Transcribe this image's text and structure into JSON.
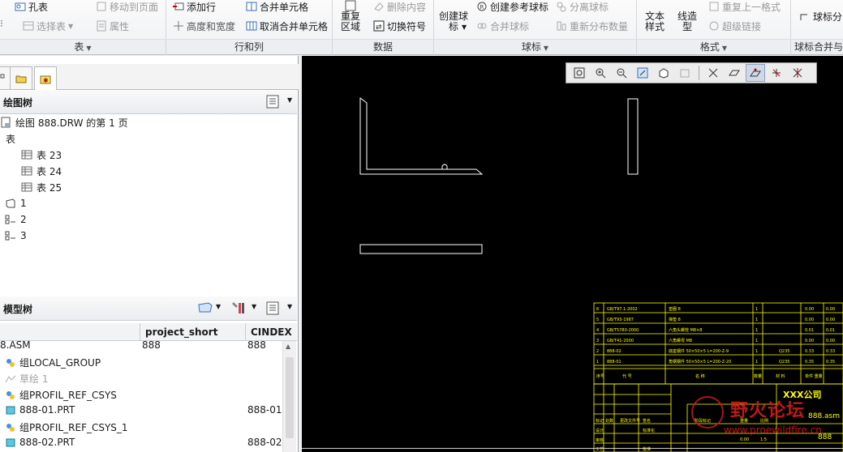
{
  "ribbon": {
    "groups": {
      "table": {
        "label": "表"
      },
      "rows_cols": {
        "label": "行和列"
      },
      "data": {
        "label": "数据"
      },
      "balloons": {
        "label": "球标"
      },
      "format": {
        "label": "格式"
      },
      "balloon_merge": {
        "label": "球标合并与"
      }
    },
    "buttons": {
      "hole_table": "孔表",
      "select_table": "选择表",
      "move_to_page": "移动到页面",
      "properties": "属性",
      "add_row": "添加行",
      "height_width": "高度和宽度",
      "merge_cells": "合并单元格",
      "unmerge_cells": "取消合并单元格",
      "repeat_region": "重复\n区域",
      "delete_content": "删除内容",
      "switch_symbol": "切换符号",
      "create_balloon": "创建球\n标",
      "create_ref_balloon": "创建参考球标",
      "merge_balloons": "合并球标",
      "detach_balloon": "分离球标",
      "redistribute_qty": "重新分布数量",
      "text_style": "文本\n样式",
      "line_style": "线造\n型",
      "repeat_last_format": "重复上一格式",
      "hyperlink": "超级链接",
      "balloon_split": "球标分"
    }
  },
  "drawing_tree": {
    "title": "绘图树",
    "items": [
      {
        "label": "绘图 888.DRW 的第 1 页"
      },
      {
        "label": "表"
      },
      {
        "label": "表 23"
      },
      {
        "label": "表 24"
      },
      {
        "label": "表 25"
      },
      {
        "label": "1"
      },
      {
        "label": "2"
      },
      {
        "label": "3"
      }
    ]
  },
  "model_tree": {
    "title": "模型树",
    "columns": [
      "project_short",
      "CINDEX"
    ],
    "rows": [
      {
        "name": "8.ASM",
        "project_short": "888",
        "cindex": "888"
      },
      {
        "name": "组LOCAL_GROUP",
        "project_short": "",
        "cindex": ""
      },
      {
        "name": "草绘 1",
        "project_short": "",
        "cindex": ""
      },
      {
        "name": "组PROFIL_REF_CSYS",
        "project_short": "",
        "cindex": ""
      },
      {
        "name": "888-01.PRT",
        "project_short": "",
        "cindex": "888-01"
      },
      {
        "name": "组PROFIL_REF_CSYS_1",
        "project_short": "",
        "cindex": ""
      },
      {
        "name": "888-02.PRT",
        "project_short": "",
        "cindex": "888-02"
      }
    ]
  },
  "titleblock": {
    "company": "XXX公司",
    "asm_name": "888.asm",
    "drawing_no": "888"
  },
  "watermark": {
    "text_cn": "野火论坛",
    "text_en": "www.proewildfire.cn"
  },
  "colors": {
    "canvas_bg": "#000000",
    "geometry": "#ffffff",
    "table_lines": "#ffff00",
    "watermark_red": "#d21c1c"
  }
}
